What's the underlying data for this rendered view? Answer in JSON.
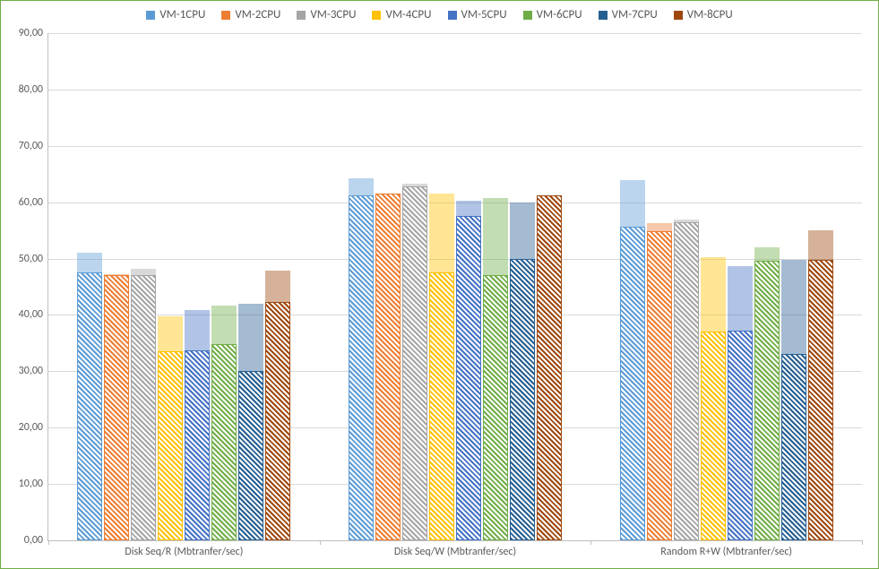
{
  "chart_data": {
    "type": "bar",
    "categories": [
      "Disk Seq/R (Mbtranfer/sec)",
      "Disk Seq/W (Mbtranfer/sec)",
      "Random R+W (Mbtranfer/sec)"
    ],
    "series": [
      {
        "name": "VM-1CPU",
        "color": "#5b9bd5",
        "values_back": [
          51.0,
          64.2,
          64.0
        ],
        "values_front": [
          47.5,
          61.2,
          55.7
        ]
      },
      {
        "name": "VM-2CPU",
        "color": "#ed7d31",
        "values_back": [
          47.3,
          61.6,
          56.3
        ],
        "values_front": [
          47.0,
          61.5,
          54.8
        ]
      },
      {
        "name": "VM-3CPU",
        "color": "#a5a5a5",
        "values_back": [
          48.2,
          63.3,
          57.0
        ],
        "values_front": [
          47.0,
          62.8,
          56.5
        ]
      },
      {
        "name": "VM-4CPU",
        "color": "#ffc000",
        "values_back": [
          39.8,
          61.6,
          50.2
        ],
        "values_front": [
          33.5,
          47.6,
          37.0
        ]
      },
      {
        "name": "VM-5CPU",
        "color": "#4472c4",
        "values_back": [
          40.8,
          60.2,
          48.7
        ],
        "values_front": [
          33.7,
          57.5,
          37.2
        ]
      },
      {
        "name": "VM-6CPU",
        "color": "#70ad47",
        "values_back": [
          41.6,
          60.8,
          52.0
        ],
        "values_front": [
          34.8,
          47.0,
          49.6
        ]
      },
      {
        "name": "VM-7CPU",
        "color": "#255e91",
        "values_back": [
          42.0,
          60.0,
          49.8
        ],
        "values_front": [
          30.0,
          50.0,
          33.0
        ]
      },
      {
        "name": "VM-8CPU",
        "color": "#9e480e",
        "values_back": [
          47.8,
          61.3,
          55.0
        ],
        "values_front": [
          42.3,
          61.2,
          49.7
        ]
      }
    ],
    "ylabel": "",
    "xlabel": "",
    "title": "",
    "ylim": [
      0,
      90
    ],
    "ystep": 10,
    "y_tick_format": "comma_decimal"
  }
}
